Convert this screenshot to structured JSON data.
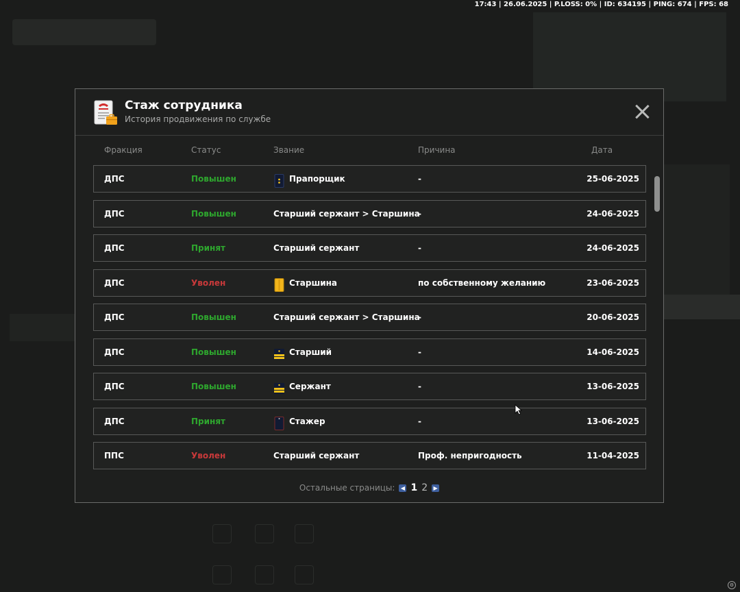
{
  "hud": "17:43 | 26.06.2025 | P.LOSS: 0% | ID: 634195 | PING: 674 | FPS: 68",
  "modal": {
    "title": "Стаж сотрудника",
    "subtitle": "История продвижения по службе"
  },
  "columns": {
    "faction": "Фракция",
    "status": "Статус",
    "rank": "Звание",
    "reason": "Причина",
    "date": "Дата"
  },
  "rows": [
    {
      "faction": "ДПС",
      "status": "Повышен",
      "status_color": "#2ea72e",
      "rank": "Прапорщик",
      "rank_icon": "ensign-shoulder-icon",
      "reason": "-",
      "date": "25-06-2025"
    },
    {
      "faction": "ДПС",
      "status": "Повышен",
      "status_color": "#2ea72e",
      "rank": "Старший сержант > Старшина",
      "rank_icon": "",
      "reason": "-",
      "date": "24-06-2025"
    },
    {
      "faction": "ДПС",
      "status": "Принят",
      "status_color": "#2ea72e",
      "rank": "Старший сержант",
      "rank_icon": "",
      "reason": "-",
      "date": "24-06-2025"
    },
    {
      "faction": "ДПС",
      "status": "Уволен",
      "status_color": "#c8393a",
      "rank": "Старшина",
      "rank_icon": "petty-officer-shoulder-icon",
      "reason": "по собственному желанию",
      "date": "23-06-2025"
    },
    {
      "faction": "ДПС",
      "status": "Повышен",
      "status_color": "#2ea72e",
      "rank": "Старший сержант > Старшина",
      "rank_icon": "",
      "reason": "-",
      "date": "20-06-2025"
    },
    {
      "faction": "ДПС",
      "status": "Повышен",
      "status_color": "#2ea72e",
      "rank": "Старший",
      "rank_icon": "senior-stripes-icon",
      "reason": "-",
      "date": "14-06-2025"
    },
    {
      "faction": "ДПС",
      "status": "Повышен",
      "status_color": "#2ea72e",
      "rank": "Сержант",
      "rank_icon": "sergeant-stripes-icon",
      "reason": "-",
      "date": "13-06-2025"
    },
    {
      "faction": "ДПС",
      "status": "Принят",
      "status_color": "#2ea72e",
      "rank": "Стажер",
      "rank_icon": "trainee-shoulder-icon",
      "reason": "-",
      "date": "13-06-2025"
    },
    {
      "faction": "ППС",
      "status": "Уволен",
      "status_color": "#c8393a",
      "rank": "Старший сержант",
      "rank_icon": "",
      "reason": "Проф. непригодность",
      "date": "11-04-2025"
    }
  ],
  "pager": {
    "label": "Остальные страницы:",
    "pages": [
      "1",
      "2"
    ],
    "current": "1"
  }
}
